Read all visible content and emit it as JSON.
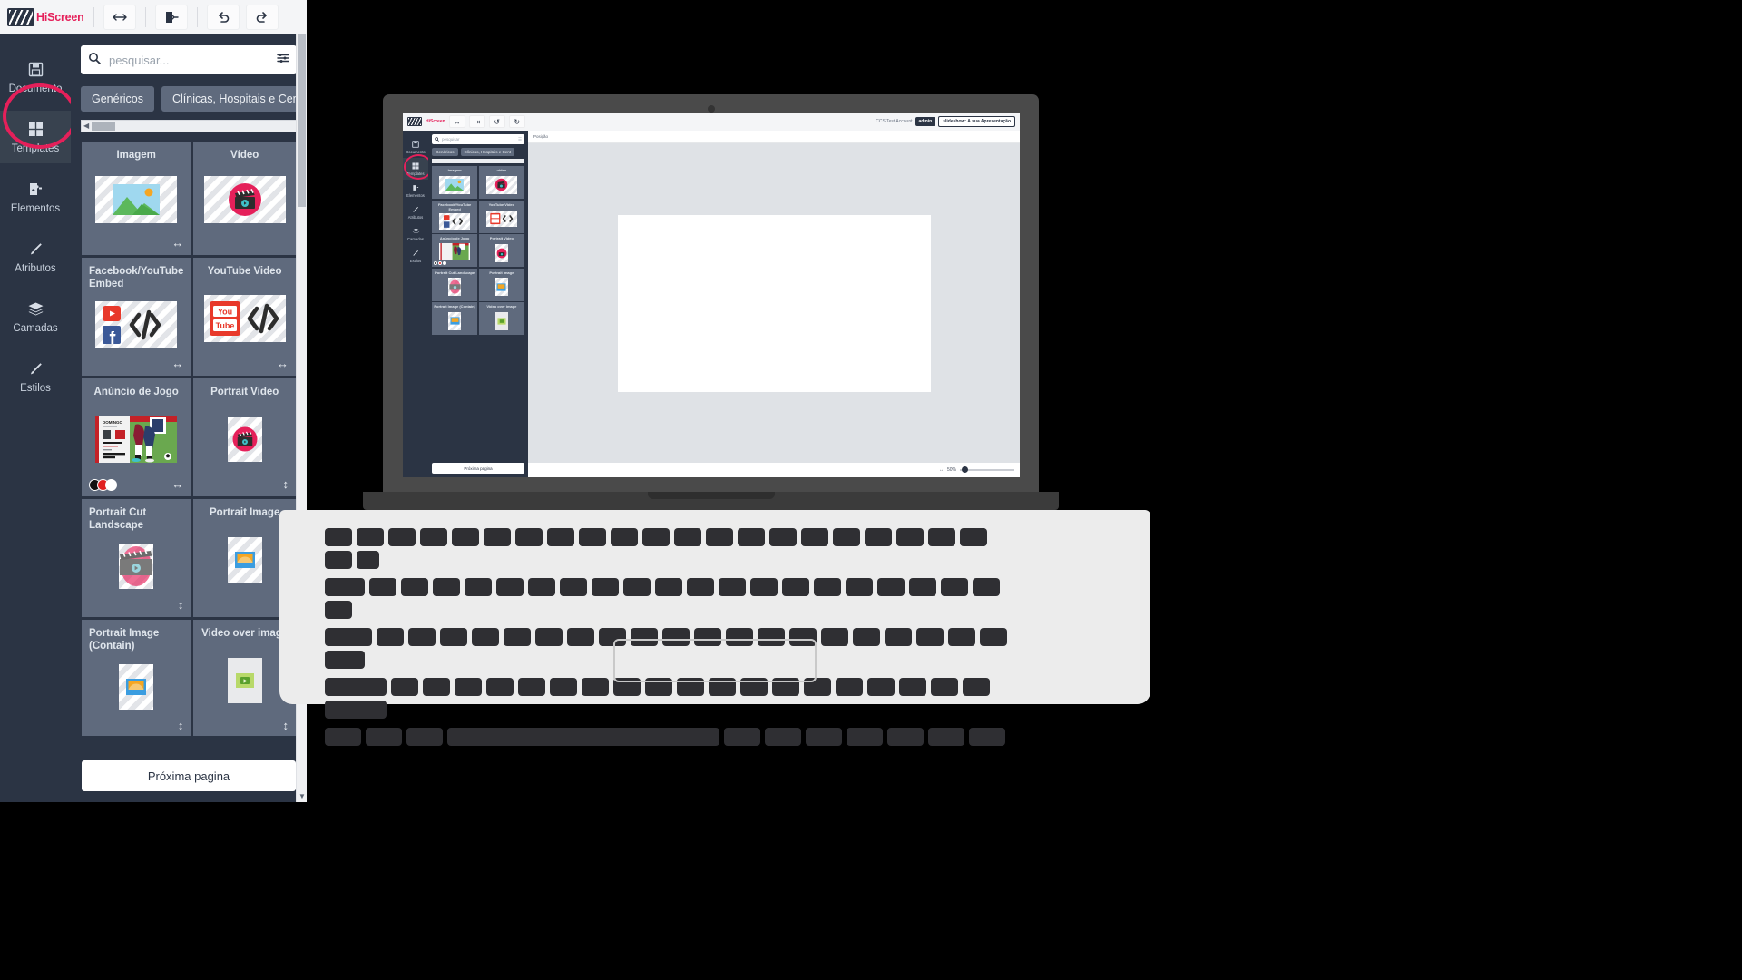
{
  "app": {
    "brand": "HiScreen",
    "toolbar": {
      "buttons": [
        {
          "name": "resize-horizontal-icon",
          "glyph": "↔"
        },
        {
          "name": "exit-icon",
          "glyph": "⇥"
        },
        {
          "name": "undo-icon",
          "glyph": "↺"
        },
        {
          "name": "redo-icon",
          "glyph": "↻"
        }
      ]
    },
    "sidebar": {
      "items": [
        {
          "label": "Documento",
          "icon": "save-document-icon",
          "active": false
        },
        {
          "label": "Templates",
          "icon": "grid-templates-icon",
          "active": true
        },
        {
          "label": "Elementos",
          "icon": "puzzle-piece-icon",
          "active": false
        },
        {
          "label": "Atributos",
          "icon": "brush-icon",
          "active": false
        },
        {
          "label": "Camadas",
          "icon": "layers-icon",
          "active": false
        },
        {
          "label": "Estilos",
          "icon": "paint-brush-icon",
          "active": false
        }
      ]
    },
    "panel": {
      "search": {
        "placeholder": "pesquisar...",
        "value": "",
        "icon": "search-icon",
        "filter_icon": "filter-sliders-icon"
      },
      "chips": [
        "Genéricos",
        "Clínicas, Hospitais e Cent"
      ],
      "next_page_button": "Próxima pagina",
      "templates": [
        {
          "title": "Imagem",
          "thumb": "image-placeholder",
          "orientation": "landscape",
          "handle": "horizontal-resize-icon",
          "swatches": []
        },
        {
          "title": "Vídeo",
          "thumb": "video-clapper",
          "orientation": "landscape",
          "handle": "",
          "swatches": []
        },
        {
          "title": "Facebook/YouTube Embed",
          "thumb": "embed-code",
          "orientation": "landscape",
          "handle": "horizontal-resize-icon",
          "swatches": []
        },
        {
          "title": "YouTube Video",
          "thumb": "youtube-code",
          "orientation": "landscape",
          "handle": "horizontal-resize-icon",
          "swatches": []
        },
        {
          "title": "Anúncio de Jogo",
          "thumb": "match-poster",
          "orientation": "landscape",
          "handle": "horizontal-resize-icon",
          "swatches": [
            "#111111",
            "#e02020",
            "#ffffff"
          ]
        },
        {
          "title": "Portrait Video",
          "thumb": "video-clapper",
          "orientation": "portrait",
          "handle": "vertical-resize-icon",
          "swatches": []
        },
        {
          "title": "Portrait Cut Landscape",
          "thumb": "cut-clapper",
          "orientation": "portrait",
          "handle": "vertical-resize-icon",
          "swatches": []
        },
        {
          "title": "Portrait Image",
          "thumb": "image-placeholder",
          "orientation": "portrait",
          "handle": "vertical-resize-icon",
          "swatches": []
        },
        {
          "title": "Portrait Image (Contain)",
          "thumb": "image-placeholder",
          "orientation": "portrait",
          "handle": "vertical-resize-icon",
          "swatches": []
        },
        {
          "title": "Video over image",
          "thumb": "video-over-image",
          "orientation": "portrait",
          "handle": "vertical-resize-icon",
          "swatches": []
        }
      ]
    }
  },
  "preview": {
    "device": "laptop-mockup",
    "inner": {
      "brand": "HiScreen",
      "account": "CCS Test Account",
      "role_badge": "admin",
      "slideshow_badge": "slideshow: A sua Apresentação",
      "sidebar_items": [
        {
          "label": "Documento"
        },
        {
          "label": "Templates"
        },
        {
          "label": "Elementos"
        },
        {
          "label": "Atributos"
        },
        {
          "label": "Camadas"
        },
        {
          "label": "Estilos"
        }
      ],
      "search_placeholder": "pesquisar",
      "chips": [
        "Genéricos",
        "Clínicas, Hospitais e Cent"
      ],
      "property_label": "Posição",
      "next_page_button": "Próxima pagina",
      "zoom_level": "50%",
      "templates": [
        {
          "title": "imagem"
        },
        {
          "title": "video"
        },
        {
          "title": "Facebook/YouTube Embed"
        },
        {
          "title": "YouTube Video"
        },
        {
          "title": "Anúncio de Jogo"
        },
        {
          "title": "Portrait Video"
        },
        {
          "title": "Portrait Cut Landscape"
        },
        {
          "title": "Portrait Image"
        },
        {
          "title": "Portrait Image (Contain)"
        },
        {
          "title": "Video over image"
        }
      ]
    }
  },
  "colors": {
    "accent": "#e5205a",
    "panel_bg": "#2b3444",
    "card_bg": "#5f6a7d",
    "topbar_bg": "#f4f5f7"
  }
}
